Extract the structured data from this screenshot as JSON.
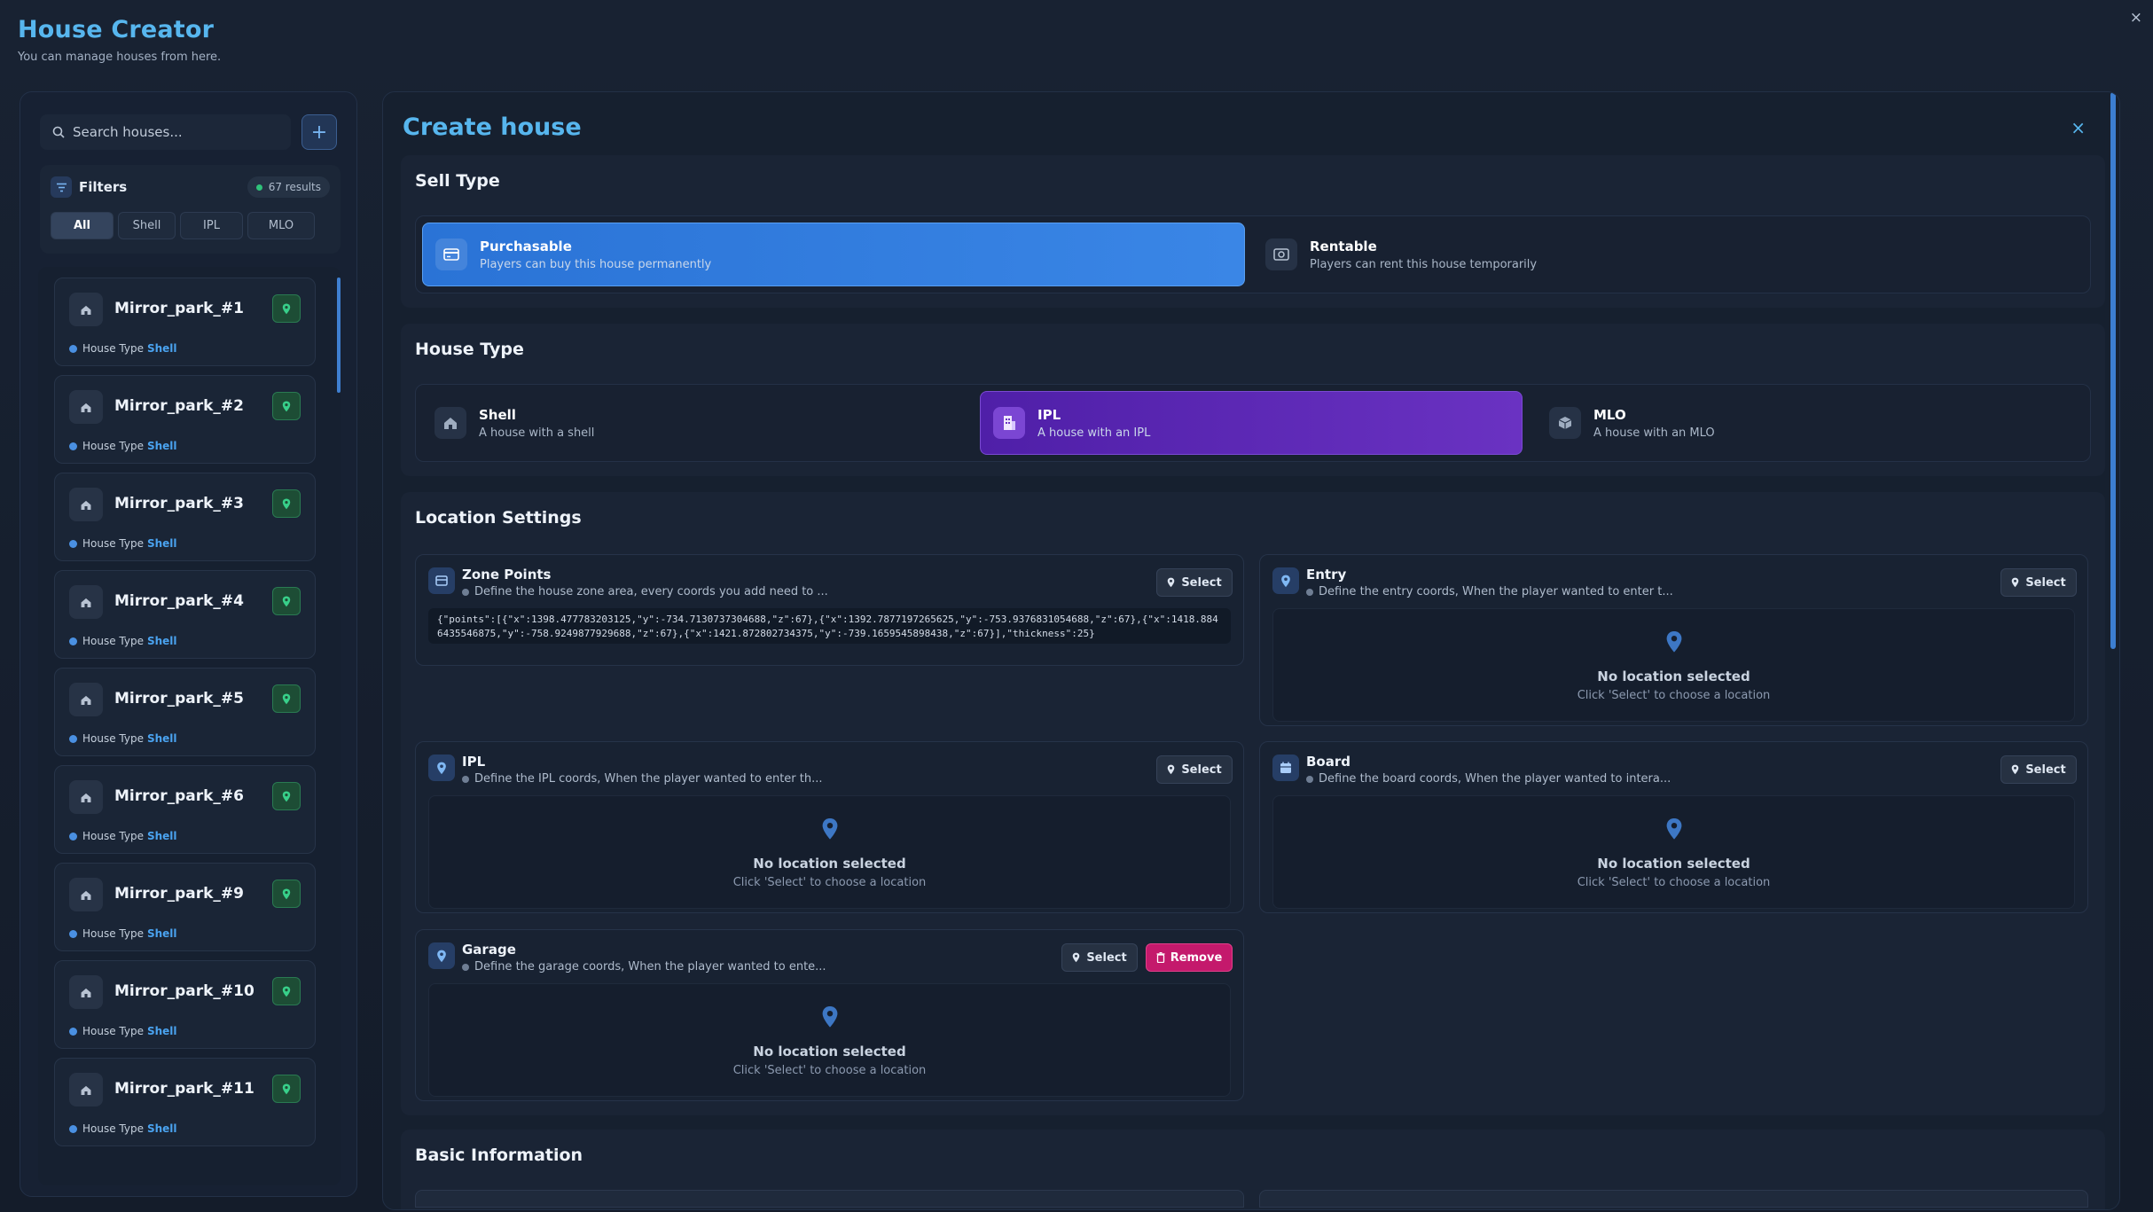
{
  "app": {
    "title": "House Creator",
    "subtitle": "You can manage houses from here.",
    "close_label": "×"
  },
  "sidebar": {
    "search_placeholder": "Search houses...",
    "add_label": "+",
    "filters_label": "Filters",
    "results": "67 results",
    "filter_tabs": [
      "All",
      "Shell",
      "IPL",
      "MLO"
    ],
    "active_filter": "All",
    "type_label": "House Type",
    "houses": [
      {
        "name": "Mirror_park_#1",
        "type": "Shell"
      },
      {
        "name": "Mirror_park_#2",
        "type": "Shell"
      },
      {
        "name": "Mirror_park_#3",
        "type": "Shell"
      },
      {
        "name": "Mirror_park_#4",
        "type": "Shell"
      },
      {
        "name": "Mirror_park_#5",
        "type": "Shell"
      },
      {
        "name": "Mirror_park_#6",
        "type": "Shell"
      },
      {
        "name": "Mirror_park_#9",
        "type": "Shell"
      },
      {
        "name": "Mirror_park_#10",
        "type": "Shell"
      },
      {
        "name": "Mirror_park_#11",
        "type": "Shell"
      }
    ]
  },
  "main": {
    "title": "Create house",
    "close_label": "×",
    "sell_type": {
      "title": "Sell Type",
      "options": [
        {
          "title": "Purchasable",
          "desc": "Players can buy this house permanently"
        },
        {
          "title": "Rentable",
          "desc": "Players can rent this house temporarily"
        }
      ],
      "selected": "Purchasable"
    },
    "house_type": {
      "title": "House Type",
      "options": [
        {
          "title": "Shell",
          "desc": "A house with a shell"
        },
        {
          "title": "IPL",
          "desc": "A house with an IPL"
        },
        {
          "title": "MLO",
          "desc": "A house with an MLO"
        }
      ],
      "selected": "IPL"
    },
    "location": {
      "title": "Location Settings",
      "select_label": "Select",
      "remove_label": "Remove",
      "empty_title": "No location selected",
      "empty_sub": "Click 'Select' to choose a location",
      "zone": {
        "title": "Zone Points",
        "desc": "Define the house zone area, every coords you add need to ...",
        "value": "{\"points\":[{\"x\":1398.477783203125,\"y\":-734.7130737304688,\"z\":67},{\"x\":1392.7877197265625,\"y\":-753.9376831054688,\"z\":67},{\"x\":1418.8846435546875,\"y\":-758.9249877929688,\"z\":67},{\"x\":1421.872802734375,\"y\":-739.1659545898438,\"z\":67}],\"thickness\":25}"
      },
      "entry": {
        "title": "Entry",
        "desc": "Define the entry coords, When the player wanted to enter t..."
      },
      "ipl": {
        "title": "IPL",
        "desc": "Define the IPL coords, When the player wanted to enter th..."
      },
      "board": {
        "title": "Board",
        "desc": "Define the board coords, When the player wanted to intera..."
      },
      "garage": {
        "title": "Garage",
        "desc": "Define the garage coords, When the player wanted to ente..."
      }
    },
    "basic_info": {
      "title": "Basic Information"
    }
  },
  "colors": {
    "accent": "#57b6ee",
    "selected_blue": "#2f7be0",
    "selected_purple": "#5a27b5",
    "remove": "#c4196c",
    "location_green": "#2fc27a"
  }
}
